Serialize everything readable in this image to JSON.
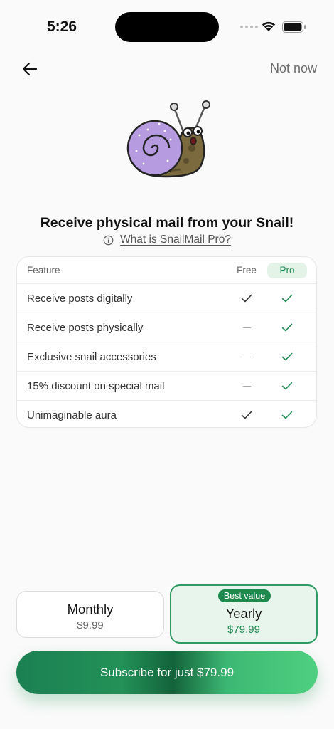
{
  "status_bar": {
    "time": "5:26"
  },
  "nav": {
    "back_icon": "arrow-left-icon",
    "not_now_label": "Not now"
  },
  "headline": "Receive physical mail from your Snail!",
  "what_is_link": "What is SnailMail Pro?",
  "table": {
    "headers": {
      "feature": "Feature",
      "free": "Free",
      "pro": "Pro"
    },
    "rows": [
      {
        "label": "Receive posts digitally",
        "free": "check",
        "pro": "check"
      },
      {
        "label": "Receive posts physically",
        "free": "dash",
        "pro": "check"
      },
      {
        "label": "Exclusive snail accessories",
        "free": "dash",
        "pro": "check"
      },
      {
        "label": "15% discount on special mail",
        "free": "dash",
        "pro": "check"
      },
      {
        "label": "Unimaginable aura",
        "free": "check",
        "pro": "check"
      }
    ]
  },
  "plans": {
    "monthly": {
      "name": "Monthly",
      "price": "$9.99"
    },
    "yearly": {
      "name": "Yearly",
      "price": "$79.99",
      "badge": "Best value",
      "selected": true
    }
  },
  "cta_label": "Subscribe for just $79.99",
  "colors": {
    "accent": "#1f8a52",
    "pro_pill_bg": "#e3f3e8",
    "yearly_bg": "#e7f5ec"
  }
}
